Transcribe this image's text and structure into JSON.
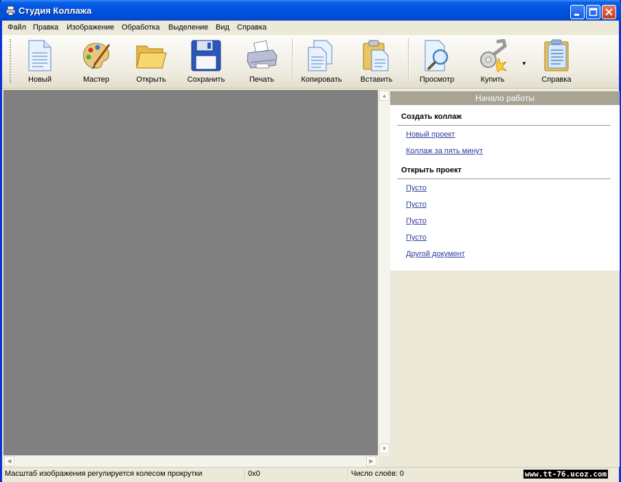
{
  "window": {
    "title": "Студия Коллажа"
  },
  "menu": [
    "Файл",
    "Правка",
    "Изображение",
    "Обработка",
    "Выделение",
    "Вид",
    "Справка"
  ],
  "toolbar": {
    "new": "Новый",
    "wizard": "Мастер",
    "open": "Открыть",
    "save": "Сохранить",
    "print": "Печать",
    "copy": "Копировать",
    "paste": "Вставить",
    "preview": "Просмотр",
    "buy": "Купить",
    "help": "Справка"
  },
  "panel": {
    "header": "Начало работы",
    "create_title": "Создать коллаж",
    "create_links": [
      "Новый проект",
      "Коллаж за пять минут"
    ],
    "open_title": "Открыть проект",
    "open_links": [
      "Пусто",
      "Пусто",
      "Пусто",
      "Пусто",
      "Другой документ"
    ]
  },
  "status": {
    "hint": "Масштаб изображения регулируется колесом прокрутки",
    "size": "0x0",
    "layers": "Число слоёв: 0"
  },
  "watermark": "www.tt-76.ucoz.com",
  "colors": {
    "titlebar": "#0054e3",
    "canvas": "#808080",
    "link": "#2f3a9c",
    "panel_header": "#a8a494"
  },
  "icons": [
    "new-document-icon",
    "palette-icon",
    "folder-icon",
    "floppy-disk-icon",
    "printer-icon",
    "copy-icon",
    "paste-icon",
    "magnifier-icon",
    "keys-icon",
    "help-book-icon"
  ]
}
